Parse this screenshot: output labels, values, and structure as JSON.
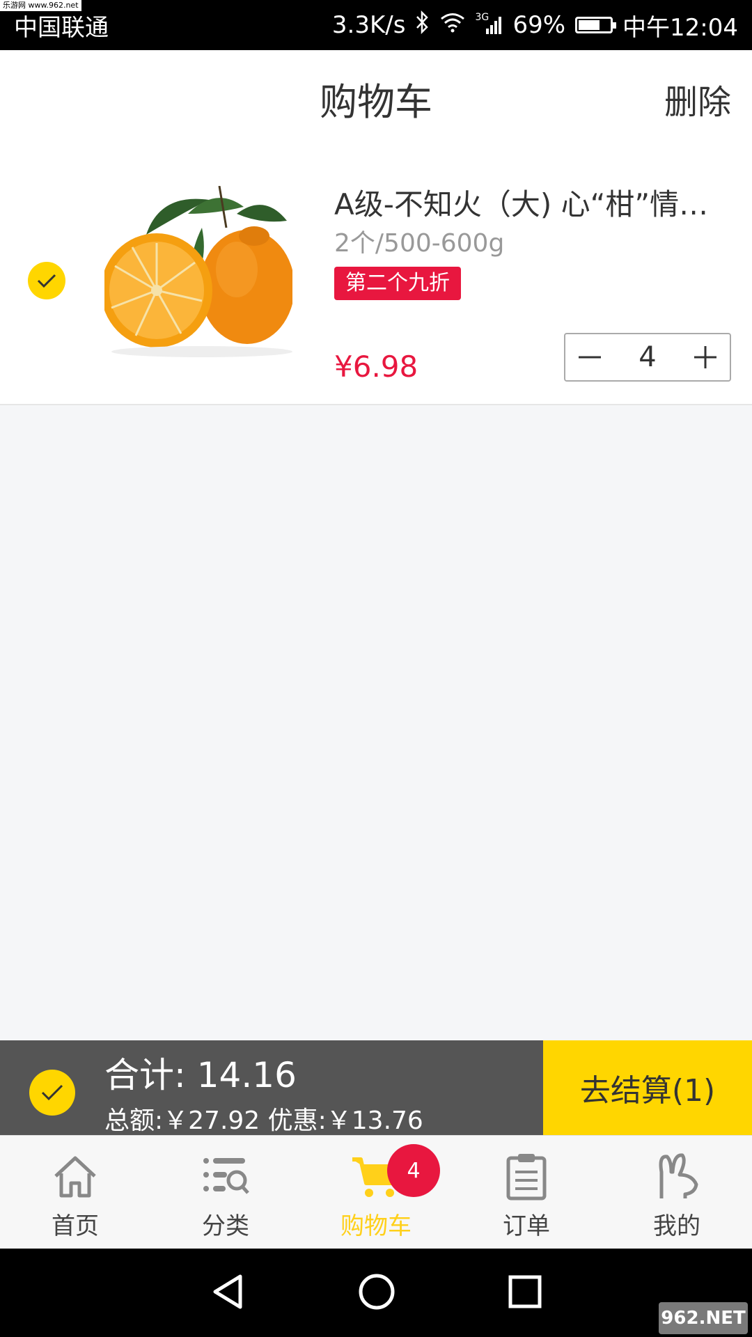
{
  "status_bar": {
    "watermark": "乐游网 www.962.net",
    "carrier": "中国联通",
    "speed": "3.3K/s",
    "network": "3G",
    "battery": "69%",
    "battery_level": 0.69,
    "time": "中午12:04"
  },
  "header": {
    "title": "购物车",
    "delete_label": "删除"
  },
  "cart": {
    "items": [
      {
        "title": "A级-不知火（大) 心“柑”情…",
        "spec": "2个/500-600g",
        "tag": "第二个九折",
        "price": "¥6.98",
        "quantity": "4",
        "selected": true
      }
    ]
  },
  "summary": {
    "total": "合计: 14.16",
    "breakdown": "总额:￥27.92  优惠:￥13.76",
    "checkout_label": "去结算(1)"
  },
  "tabs": [
    {
      "label": "首页",
      "icon": "home-icon"
    },
    {
      "label": "分类",
      "icon": "category-search-icon"
    },
    {
      "label": "购物车",
      "icon": "cart-icon",
      "badge": "4",
      "active": true
    },
    {
      "label": "订单",
      "icon": "clipboard-icon"
    },
    {
      "label": "我的",
      "icon": "rabbit-icon"
    }
  ],
  "colors": {
    "accent_yellow": "#ffd600",
    "price_red": "#e8173f",
    "summary_gray": "#555555"
  },
  "bottom_watermark": "962.NET"
}
